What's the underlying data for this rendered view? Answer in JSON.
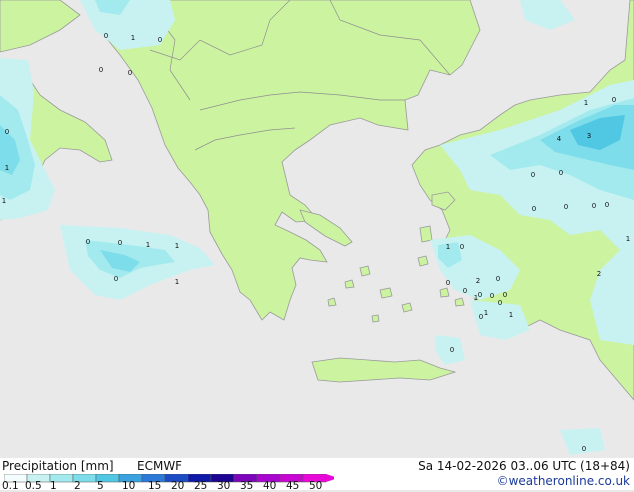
{
  "map": {
    "colors": {
      "sea": "#e9e9e9",
      "land": "#ccf3a0",
      "coast": "#9a9a9a",
      "border": "#8f8f8f"
    },
    "precip_labels": [
      "0",
      "1",
      "0",
      "0",
      "0",
      "0",
      "1",
      "1",
      "0",
      "0",
      "1",
      "1",
      "0",
      "1",
      "1",
      "0",
      "0",
      "2",
      "4",
      "3",
      "0",
      "1",
      "0",
      "0",
      "0",
      "0",
      "0",
      "0",
      "1",
      "2",
      "0",
      "0",
      "1",
      "0",
      "0",
      "0",
      "0",
      "1",
      "0",
      "1",
      "0",
      "0"
    ]
  },
  "legend": {
    "title": "Precipitation [mm]",
    "model": "ECMWF",
    "ticks": [
      "0.1",
      "0.5",
      "1",
      "2",
      "5",
      "10",
      "15",
      "20",
      "25",
      "30",
      "35",
      "40",
      "45",
      "50"
    ],
    "colors": [
      "#f4fdfd",
      "#c8f2f2",
      "#a3eaee",
      "#7dddea",
      "#50c7e3",
      "#3aa2df",
      "#2c79d8",
      "#1c4cc4",
      "#101aa8",
      "#1d0592",
      "#7d06bc",
      "#a806d0",
      "#c907d3",
      "#e808d8"
    ]
  },
  "datetime": "Sa 14-02-2026 03..06 UTC (18+84)",
  "credit": "©weatheronline.co.uk"
}
